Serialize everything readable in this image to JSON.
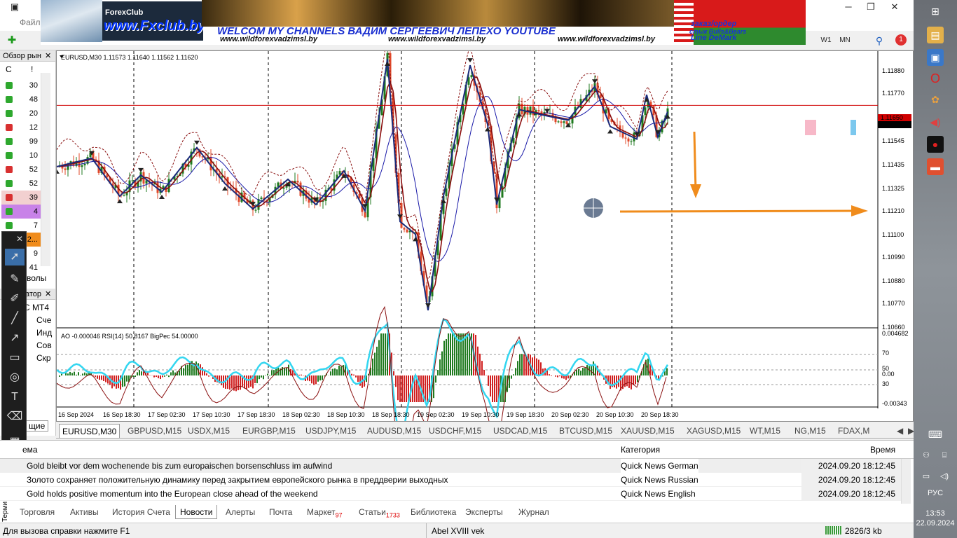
{
  "menubar": {
    "file_label": "Файл"
  },
  "banner": {
    "logo_small": "ForexClub",
    "logo": "www.Fxclub.by",
    "welcome": "WELCOM MY CHANNELS ВАДИМ СЕРГЕЕВИЧ ЛЕПЕХО YOUTUBE",
    "sites": [
      "www.wildforexvadzimsl.by",
      "www.wildforexvadzimsl.by",
      "www.wildforexvadzimsl.by"
    ],
    "order_text": "заказ/ордер",
    "bulls_text": "стык Bulls&Bears",
    "demark_text": "Line DeMark"
  },
  "toolbar": {
    "w1": "W1",
    "mn": "MN",
    "notif_count": "1"
  },
  "market_watch": {
    "title": "Обзор рын",
    "col_symbol": "С",
    "col_bang": "!",
    "rows": [
      {
        "dir": "up",
        "value": "30"
      },
      {
        "dir": "up",
        "value": "48"
      },
      {
        "dir": "up",
        "value": "20"
      },
      {
        "dir": "down",
        "value": "12"
      },
      {
        "dir": "up",
        "value": "99"
      },
      {
        "dir": "up",
        "value": "10"
      },
      {
        "dir": "down",
        "value": "52"
      },
      {
        "dir": "up",
        "value": "52"
      },
      {
        "dir": "down",
        "value": "39"
      },
      {
        "dir": "up",
        "value": "4"
      },
      {
        "dir": "up",
        "value": "7"
      },
      {
        "dir": "up",
        "value": "2..."
      },
      {
        "dir": "up",
        "value": "9"
      },
      {
        "dir": "up",
        "value": "41"
      }
    ],
    "symbols_tab": "волы"
  },
  "navigator": {
    "title": "атор",
    "items": [
      "C MT4",
      "Сче",
      "Инд",
      "Сов",
      "Скр"
    ],
    "bottom_tab": "щие"
  },
  "chart": {
    "header": "EURUSD,M30  1.11573 1.11640 1.11562 1.11620",
    "current_price": "1.11620",
    "line_price": "1.11650",
    "price_ticks": [
      "1.11880",
      "1.11770",
      "1.11655",
      "1.11545",
      "1.11435",
      "1.11325",
      "1.11210",
      "1.11100",
      "1.10990",
      "1.10880",
      "1.10770",
      "1.10660"
    ],
    "indicator_header": "AO -0.000046  RSI(14) 50.8167  BigPec 54.00000",
    "indicator_ticks": [
      "0.004682",
      "70",
      "50",
      "0.00",
      "30",
      "-0.00343"
    ],
    "time_ticks": [
      "16 Sep 2024",
      "16 Sep 18:30",
      "17 Sep 02:30",
      "17 Sep 10:30",
      "17 Sep 18:30",
      "18 Sep 02:30",
      "18 Sep 10:30",
      "18 Sep 18:30",
      "19 Sep 02:30",
      "19 Sep 10:30",
      "19 Sep 18:30",
      "20 Sep 02:30",
      "20 Sep 10:30",
      "20 Sep 18:30"
    ]
  },
  "chart_tabs": [
    "EURUSD,M30",
    "GBPUSD,M15",
    "USDX,M15",
    "EURGBP,M15",
    "USDJPY,M15",
    "AUDUSD,M15",
    "USDCHF,M15",
    "USDCAD,M15",
    "BTCUSD,M15",
    "XAUUSD,M15",
    "XAGUSD,M15",
    "WT,M15",
    "NG,M15",
    "FDAX,M"
  ],
  "terminal": {
    "col_title": "ема",
    "col_category": "Категория",
    "col_time": "Время",
    "news": [
      {
        "title": "Gold bleibt vor dem wochenende bis zum europaischen borsenschluss im aufwind",
        "category": "Quick News German",
        "time": "2024.09.20 18:12:45"
      },
      {
        "title": "Золото сохраняет положительную динамику перед закрытием европейского рынка в преддверии выходных",
        "category": "Quick News Russian",
        "time": "2024.09.20 18:12:45"
      },
      {
        "title": "Gold holds positive momentum into the European close ahead of the weekend",
        "category": "Quick News English",
        "time": "2024.09.20 18:12:45"
      }
    ],
    "tabs": [
      {
        "label": "Торговля"
      },
      {
        "label": "Активы"
      },
      {
        "label": "История Счета"
      },
      {
        "label": "Новости"
      },
      {
        "label": "Алерты"
      },
      {
        "label": "Почта"
      },
      {
        "label": "Маркет",
        "badge": "97"
      },
      {
        "label": "Статьи",
        "badge": "1733"
      },
      {
        "label": "Библиотека"
      },
      {
        "label": "Эксперты"
      },
      {
        "label": "Журнал"
      }
    ],
    "side_label": "Терми"
  },
  "status": {
    "help": "Для вызова справки нажмите F1",
    "profile": "Abel XVIII vek",
    "traffic": "2826/3 kb"
  },
  "taskbar": {
    "lang": "РУС",
    "time": "13:53",
    "date": "22.09.2024"
  },
  "colors": {
    "bull": "#1f7a1f",
    "bear": "#e0482a",
    "zigzag": "#1a2a7a",
    "rsi": "#33d6f0",
    "arrow": "#f08c1c",
    "price_line": "#d00000"
  }
}
